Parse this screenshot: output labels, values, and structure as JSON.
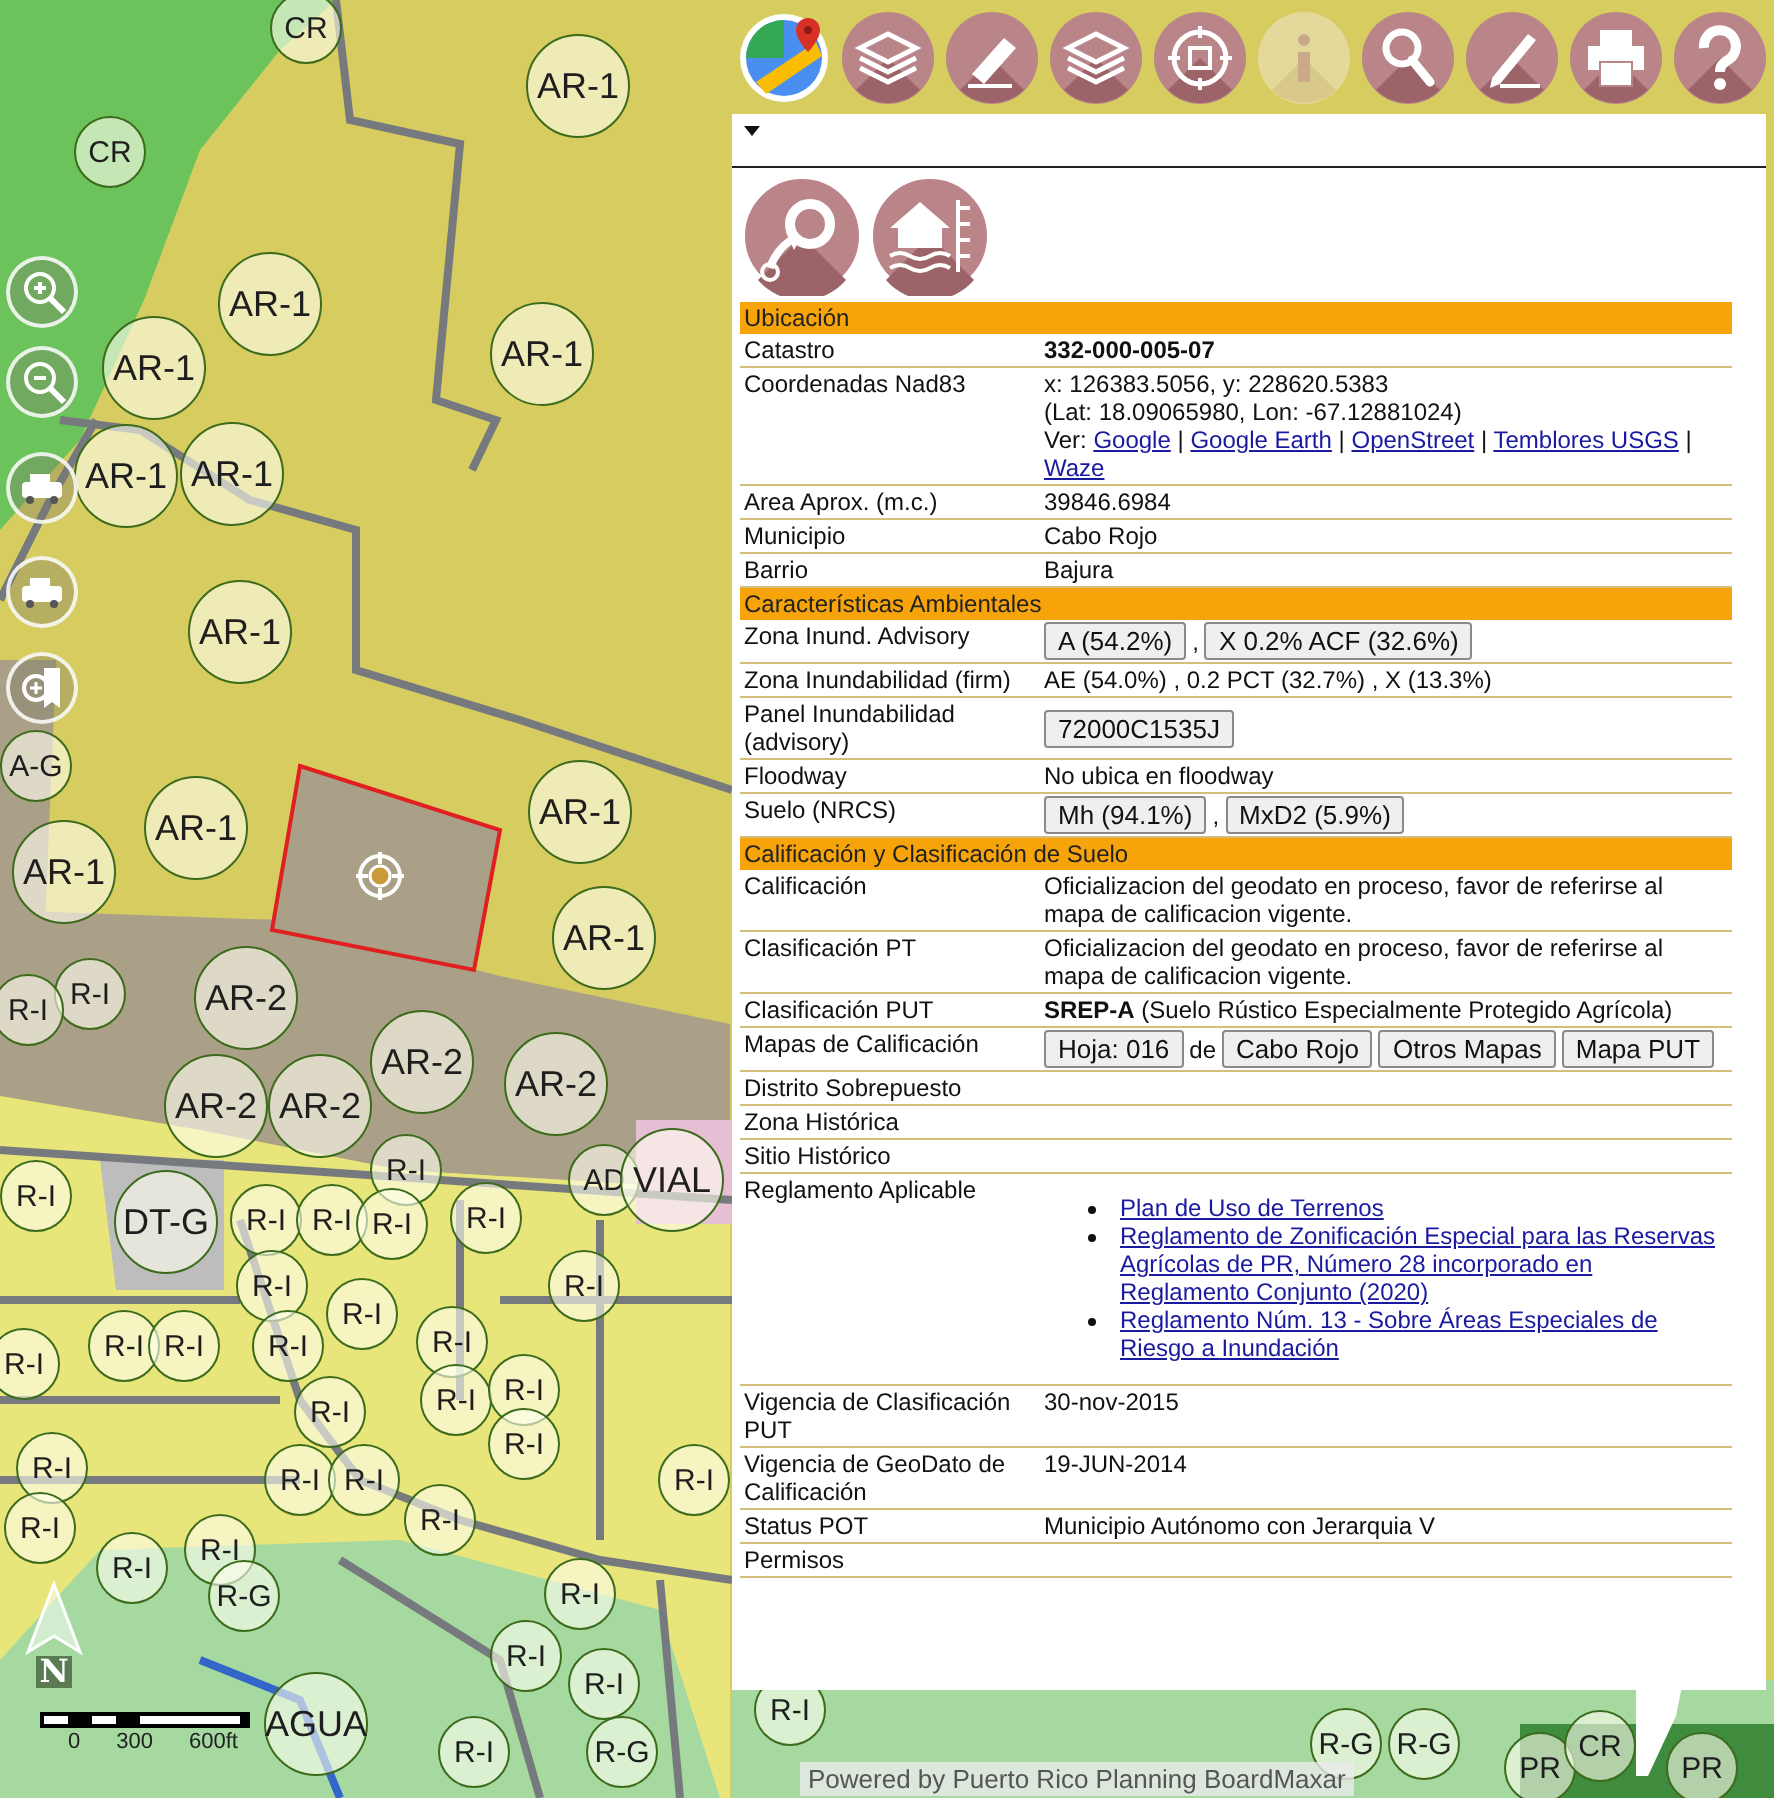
{
  "toolbar": {
    "tools": [
      {
        "kind": "maps",
        "disabled": false
      },
      {
        "kind": "layers",
        "disabled": false
      },
      {
        "kind": "eraser",
        "disabled": false
      },
      {
        "kind": "layers",
        "disabled": false
      },
      {
        "kind": "globe",
        "disabled": false
      },
      {
        "kind": "info",
        "disabled": true
      },
      {
        "kind": "search",
        "disabled": false
      },
      {
        "kind": "draw",
        "disabled": false
      },
      {
        "kind": "print",
        "disabled": false
      },
      {
        "kind": "help",
        "disabled": false
      }
    ]
  },
  "map": {
    "zone_labels": [
      "CR",
      "AR-1",
      "CR",
      "AR-1",
      "AR-1",
      "AR-1",
      "AR-1",
      "AR-1",
      "AR-1",
      "AR-1",
      "AR-1",
      "A-G",
      "AR-1",
      "AR-1",
      "AR-2",
      "AR-2",
      "AR-2",
      "AR-2",
      "AR-2",
      "DT-G",
      "AD",
      "VIAL",
      "R-I",
      "R-I",
      "R-I",
      "R-I",
      "R-I",
      "R-I",
      "R-I",
      "R-I",
      "R-I",
      "R-I",
      "R-I",
      "R-I",
      "R-I",
      "R-I",
      "R-I",
      "R-I",
      "R-I",
      "R-I",
      "R-I",
      "R-I",
      "R-I",
      "R-I",
      "R-I",
      "R-I",
      "R-I",
      "R-I",
      "R-I",
      "R-I",
      "R-I",
      "R-I",
      "R-I",
      "R-G",
      "R-I",
      "AGUA",
      "R-I",
      "R-G",
      "R-G",
      "R-G",
      "PR",
      "CR",
      "PR"
    ],
    "controls": [
      {
        "kind": "zoom-in"
      },
      {
        "kind": "zoom-out"
      },
      {
        "kind": "vehicle"
      },
      {
        "kind": "vehicle"
      },
      {
        "kind": "bookmark-zoom"
      }
    ],
    "north": "N",
    "scale": [
      "0",
      "300",
      "600ft"
    ],
    "attribution": "Powered by Puerto Rico Planning BoardMaxar"
  },
  "panel": {
    "actions": [
      {
        "kind": "refresh"
      },
      {
        "kind": "flood"
      }
    ],
    "sections": [
      {
        "title": "Ubicación",
        "rows": [
          {
            "label": "Catastro",
            "kind": "strong",
            "value": "332-000-005-07"
          },
          {
            "label": "Coordenadas Nad83",
            "kind": "coords",
            "lines": [
              "x: 126383.5056, y: 228620.5383",
              "(Lat: 18.09065980, Lon: -67.12881024)"
            ],
            "prefix": "Ver:",
            "links": [
              "Google",
              "Google Earth",
              "OpenStreet",
              "Temblores USGS",
              "Waze"
            ],
            "separator": "|"
          },
          {
            "label": "Area Aprox. (m.c.)",
            "kind": "text",
            "value": "39846.6984"
          },
          {
            "label": "Municipio",
            "kind": "text",
            "value": "Cabo Rojo"
          },
          {
            "label": "Barrio",
            "kind": "text",
            "value": "Bajura"
          }
        ]
      },
      {
        "title": "Características Ambientales",
        "rows": [
          {
            "label": "Zona Inund. Advisory",
            "kind": "parts",
            "parts": [
              {
                "kind": "button",
                "text": "A (54.2%)"
              },
              {
                "kind": "text",
                "text": ","
              },
              {
                "kind": "button",
                "text": "X 0.2% ACF (32.6%)"
              }
            ]
          },
          {
            "label": "Zona Inundabilidad (firm)",
            "kind": "text",
            "value": "AE (54.0%) , 0.2 PCT (32.7%) , X (13.3%)"
          },
          {
            "label": "Panel Inundabilidad (advisory)",
            "kind": "parts",
            "parts": [
              {
                "kind": "button",
                "text": "72000C1535J"
              }
            ]
          },
          {
            "label": "Floodway",
            "kind": "text",
            "value": "No ubica en floodway"
          },
          {
            "label": "Suelo (NRCS)",
            "kind": "parts",
            "parts": [
              {
                "kind": "button",
                "text": "Mh (94.1%)"
              },
              {
                "kind": "text",
                "text": ","
              },
              {
                "kind": "button",
                "text": "MxD2 (5.9%)"
              }
            ]
          }
        ]
      },
      {
        "title": "Calificación y Clasificación de Suelo",
        "rows": [
          {
            "label": "Calificación",
            "kind": "text",
            "value": "Oficializacion del geodato en proceso, favor de referirse al mapa de calificacion vigente."
          },
          {
            "label": "Clasificación PT",
            "kind": "text",
            "value": "Oficializacion del geodato en proceso, favor de referirse al mapa de calificacion vigente."
          },
          {
            "label": "Clasificación PUT",
            "kind": "rich",
            "value": "**SREP-A** (Suelo Rústico Especialmente Protegido Agrícola)"
          },
          {
            "label": "Mapas de Calificación",
            "kind": "parts",
            "parts": [
              {
                "kind": "button",
                "text": "Hoja: 016"
              },
              {
                "kind": "text",
                "text": "de"
              },
              {
                "kind": "button",
                "text": "Cabo Rojo"
              },
              {
                "kind": "button",
                "text": "Otros Mapas"
              },
              {
                "kind": "button",
                "text": "Mapa PUT"
              }
            ]
          },
          {
            "label": "Distrito Sobrepuesto",
            "kind": "empty"
          },
          {
            "label": "Zona Histórica",
            "kind": "empty"
          },
          {
            "label": "Sitio Histórico",
            "kind": "empty"
          },
          {
            "label": "Reglamento Aplicable",
            "kind": "links",
            "items": [
              "Plan de Uso de Terrenos",
              "Reglamento de Zonificación Especial para las Reservas Agrícolas de PR, Número 28 incorporado en Reglamento Conjunto (2020)",
              "Reglamento Núm. 13 - Sobre Áreas Especiales de Riesgo a Inundación"
            ]
          },
          {
            "label": "Vigencia de Clasificación PUT",
            "kind": "text",
            "value": "30-nov-2015"
          },
          {
            "label": "Vigencia de GeoDato de Calificación",
            "kind": "text",
            "value": "19-JUN-2014"
          },
          {
            "label": "Status POT",
            "kind": "text",
            "value": "Municipio Autónomo con Jerarquia V"
          },
          {
            "label": "Permisos",
            "kind": "empty"
          }
        ]
      }
    ]
  }
}
